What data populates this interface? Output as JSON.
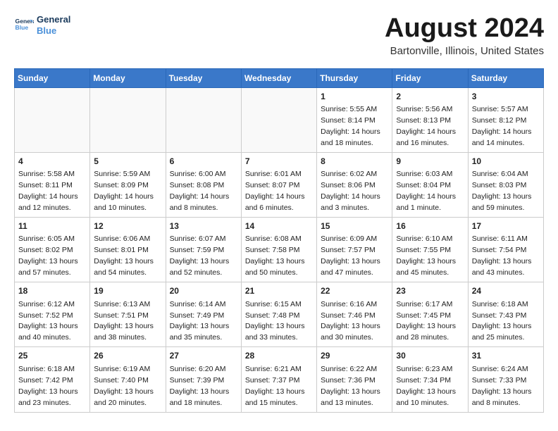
{
  "header": {
    "logo_line1": "General",
    "logo_line2": "Blue",
    "month": "August 2024",
    "location": "Bartonville, Illinois, United States"
  },
  "days_of_week": [
    "Sunday",
    "Monday",
    "Tuesday",
    "Wednesday",
    "Thursday",
    "Friday",
    "Saturday"
  ],
  "weeks": [
    [
      {
        "day": "",
        "info": ""
      },
      {
        "day": "",
        "info": ""
      },
      {
        "day": "",
        "info": ""
      },
      {
        "day": "",
        "info": ""
      },
      {
        "day": "1",
        "info": "Sunrise: 5:55 AM\nSunset: 8:14 PM\nDaylight: 14 hours\nand 18 minutes."
      },
      {
        "day": "2",
        "info": "Sunrise: 5:56 AM\nSunset: 8:13 PM\nDaylight: 14 hours\nand 16 minutes."
      },
      {
        "day": "3",
        "info": "Sunrise: 5:57 AM\nSunset: 8:12 PM\nDaylight: 14 hours\nand 14 minutes."
      }
    ],
    [
      {
        "day": "4",
        "info": "Sunrise: 5:58 AM\nSunset: 8:11 PM\nDaylight: 14 hours\nand 12 minutes."
      },
      {
        "day": "5",
        "info": "Sunrise: 5:59 AM\nSunset: 8:09 PM\nDaylight: 14 hours\nand 10 minutes."
      },
      {
        "day": "6",
        "info": "Sunrise: 6:00 AM\nSunset: 8:08 PM\nDaylight: 14 hours\nand 8 minutes."
      },
      {
        "day": "7",
        "info": "Sunrise: 6:01 AM\nSunset: 8:07 PM\nDaylight: 14 hours\nand 6 minutes."
      },
      {
        "day": "8",
        "info": "Sunrise: 6:02 AM\nSunset: 8:06 PM\nDaylight: 14 hours\nand 3 minutes."
      },
      {
        "day": "9",
        "info": "Sunrise: 6:03 AM\nSunset: 8:04 PM\nDaylight: 14 hours\nand 1 minute."
      },
      {
        "day": "10",
        "info": "Sunrise: 6:04 AM\nSunset: 8:03 PM\nDaylight: 13 hours\nand 59 minutes."
      }
    ],
    [
      {
        "day": "11",
        "info": "Sunrise: 6:05 AM\nSunset: 8:02 PM\nDaylight: 13 hours\nand 57 minutes."
      },
      {
        "day": "12",
        "info": "Sunrise: 6:06 AM\nSunset: 8:01 PM\nDaylight: 13 hours\nand 54 minutes."
      },
      {
        "day": "13",
        "info": "Sunrise: 6:07 AM\nSunset: 7:59 PM\nDaylight: 13 hours\nand 52 minutes."
      },
      {
        "day": "14",
        "info": "Sunrise: 6:08 AM\nSunset: 7:58 PM\nDaylight: 13 hours\nand 50 minutes."
      },
      {
        "day": "15",
        "info": "Sunrise: 6:09 AM\nSunset: 7:57 PM\nDaylight: 13 hours\nand 47 minutes."
      },
      {
        "day": "16",
        "info": "Sunrise: 6:10 AM\nSunset: 7:55 PM\nDaylight: 13 hours\nand 45 minutes."
      },
      {
        "day": "17",
        "info": "Sunrise: 6:11 AM\nSunset: 7:54 PM\nDaylight: 13 hours\nand 43 minutes."
      }
    ],
    [
      {
        "day": "18",
        "info": "Sunrise: 6:12 AM\nSunset: 7:52 PM\nDaylight: 13 hours\nand 40 minutes."
      },
      {
        "day": "19",
        "info": "Sunrise: 6:13 AM\nSunset: 7:51 PM\nDaylight: 13 hours\nand 38 minutes."
      },
      {
        "day": "20",
        "info": "Sunrise: 6:14 AM\nSunset: 7:49 PM\nDaylight: 13 hours\nand 35 minutes."
      },
      {
        "day": "21",
        "info": "Sunrise: 6:15 AM\nSunset: 7:48 PM\nDaylight: 13 hours\nand 33 minutes."
      },
      {
        "day": "22",
        "info": "Sunrise: 6:16 AM\nSunset: 7:46 PM\nDaylight: 13 hours\nand 30 minutes."
      },
      {
        "day": "23",
        "info": "Sunrise: 6:17 AM\nSunset: 7:45 PM\nDaylight: 13 hours\nand 28 minutes."
      },
      {
        "day": "24",
        "info": "Sunrise: 6:18 AM\nSunset: 7:43 PM\nDaylight: 13 hours\nand 25 minutes."
      }
    ],
    [
      {
        "day": "25",
        "info": "Sunrise: 6:18 AM\nSunset: 7:42 PM\nDaylight: 13 hours\nand 23 minutes."
      },
      {
        "day": "26",
        "info": "Sunrise: 6:19 AM\nSunset: 7:40 PM\nDaylight: 13 hours\nand 20 minutes."
      },
      {
        "day": "27",
        "info": "Sunrise: 6:20 AM\nSunset: 7:39 PM\nDaylight: 13 hours\nand 18 minutes."
      },
      {
        "day": "28",
        "info": "Sunrise: 6:21 AM\nSunset: 7:37 PM\nDaylight: 13 hours\nand 15 minutes."
      },
      {
        "day": "29",
        "info": "Sunrise: 6:22 AM\nSunset: 7:36 PM\nDaylight: 13 hours\nand 13 minutes."
      },
      {
        "day": "30",
        "info": "Sunrise: 6:23 AM\nSunset: 7:34 PM\nDaylight: 13 hours\nand 10 minutes."
      },
      {
        "day": "31",
        "info": "Sunrise: 6:24 AM\nSunset: 7:33 PM\nDaylight: 13 hours\nand 8 minutes."
      }
    ]
  ]
}
